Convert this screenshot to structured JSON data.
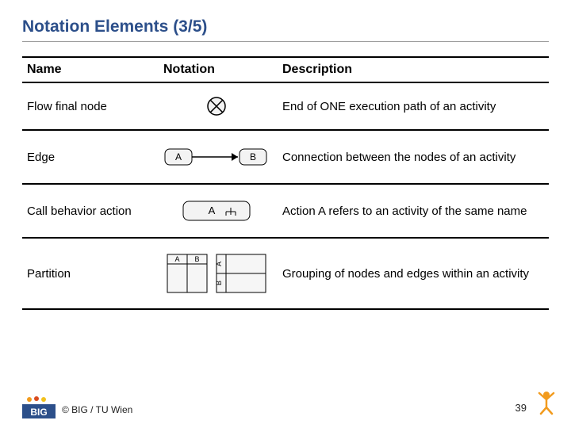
{
  "title": "Notation Elements (3/5)",
  "headers": {
    "name": "Name",
    "notation": "Notation",
    "description": "Description"
  },
  "rows": [
    {
      "name": "Flow final node",
      "description": "End of ONE execution path of an activity"
    },
    {
      "name": "Edge",
      "description": "Connection between the nodes of an activity"
    },
    {
      "name": "Call behavior action",
      "description": "Action A refers to an activity of the same name"
    },
    {
      "name": "Partition",
      "description": "Grouping of nodes and edges within an activity"
    }
  ],
  "footer": {
    "copyright": "© BIG / TU Wien",
    "page": "39",
    "logo_text": "BIG"
  }
}
